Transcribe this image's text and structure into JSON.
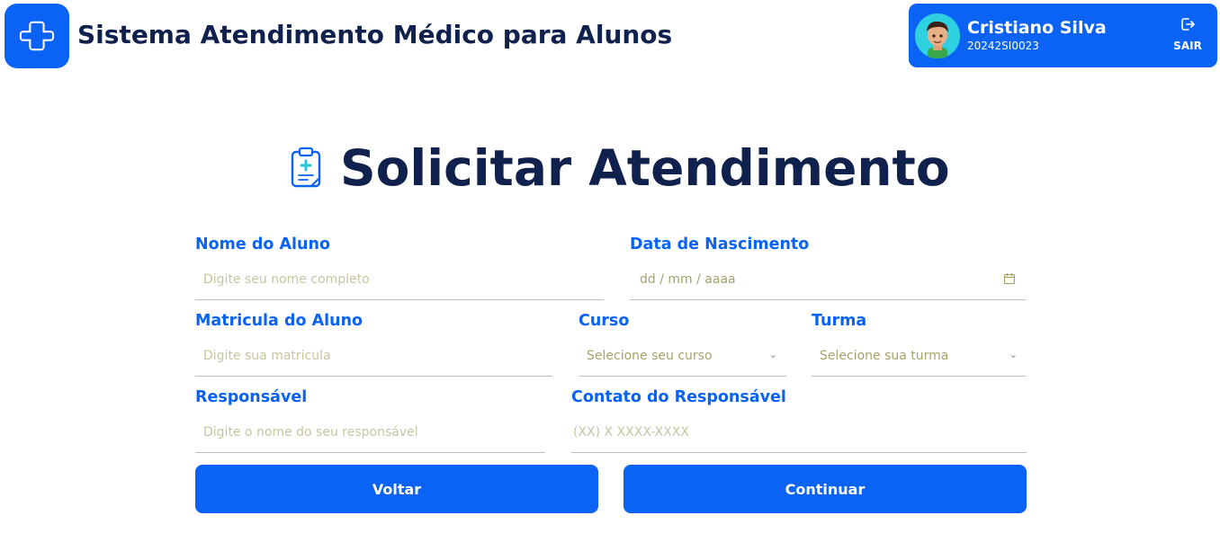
{
  "header": {
    "app_title": "Sistema Atendimento Médico para Alunos",
    "logo_icon": "medical-cross-icon"
  },
  "user": {
    "name": "Cristiano Silva",
    "id": "20242SI0023",
    "logout_label": "SAIR"
  },
  "page": {
    "title": "Solicitar Atendimento",
    "title_icon": "clipboard-medical-icon"
  },
  "form": {
    "nome": {
      "label": "Nome do Aluno",
      "placeholder": "Digite seu nome completo"
    },
    "nascimento": {
      "label": "Data de Nascimento",
      "placeholder": "dd / mm / aaaa"
    },
    "matricula": {
      "label": "Matricula do Aluno",
      "placeholder": "Digite sua matricula"
    },
    "curso": {
      "label": "Curso",
      "selected": "Selecione seu curso"
    },
    "turma": {
      "label": "Turma",
      "selected": "Selecione sua turma"
    },
    "responsavel": {
      "label": "Responsável",
      "placeholder": "Digite o nome do seu responsável"
    },
    "contato": {
      "label": "Contato do Responsável",
      "placeholder": "(XX) X XXXX-XXXX"
    }
  },
  "buttons": {
    "back_label": "Voltar",
    "continue_label": "Continuar"
  },
  "colors": {
    "primary": "#0a63f5",
    "heading": "#10214d",
    "placeholder": "#c9c4a0"
  }
}
